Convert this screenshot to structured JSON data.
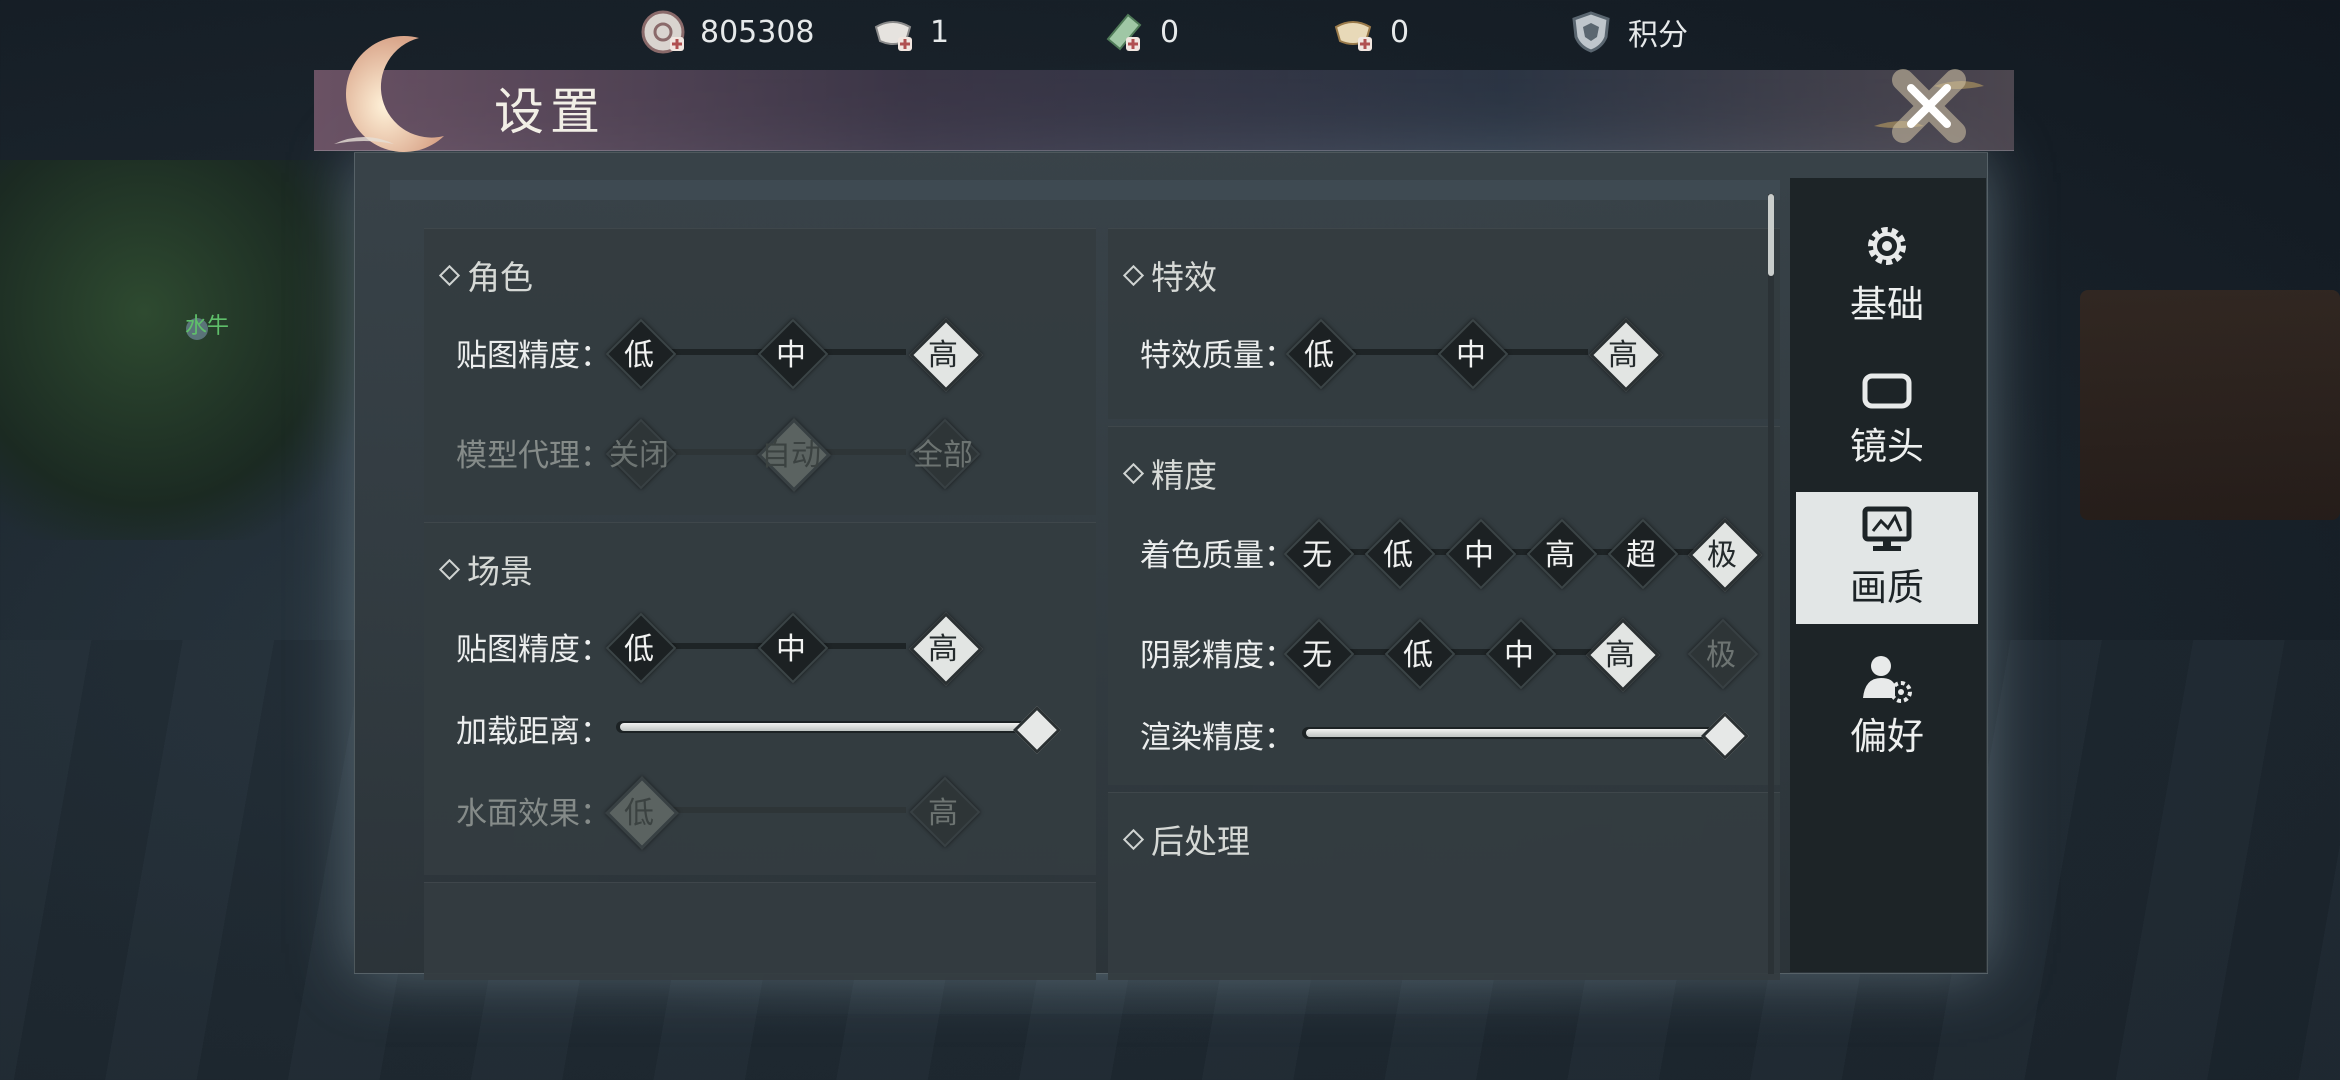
{
  "top_bar": {
    "currencies": [
      {
        "name": "coin-icon",
        "value": "805308"
      },
      {
        "name": "ingot-icon",
        "value": "1"
      },
      {
        "name": "jade-ticket-icon",
        "value": "0"
      },
      {
        "name": "gold-ingot-icon",
        "value": "0"
      }
    ],
    "points_label": "积分"
  },
  "panel": {
    "title": "设置",
    "close_icon": "close-icon"
  },
  "npc_label": "水牛",
  "sections": {
    "character": {
      "title": "角色",
      "texture": {
        "label": "贴图精度：",
        "options": [
          "低",
          "中",
          "高"
        ],
        "selected": "高"
      },
      "model_proxy": {
        "label": "模型代理：",
        "options": [
          "关闭",
          "自动",
          "全部"
        ],
        "selected": "自动",
        "disabled": true
      }
    },
    "scene": {
      "title": "场景",
      "texture": {
        "label": "贴图精度：",
        "options": [
          "低",
          "中",
          "高"
        ],
        "selected": "高"
      },
      "load_distance": {
        "label": "加载距离：",
        "value": 1.0
      },
      "water": {
        "label": "水面效果：",
        "options": [
          "低",
          "高"
        ],
        "selected": "低",
        "disabled": true
      }
    },
    "effects": {
      "title": "特效",
      "quality": {
        "label": "特效质量：",
        "options": [
          "低",
          "中",
          "高"
        ],
        "selected": "高"
      }
    },
    "precision": {
      "title": "精度",
      "shading": {
        "label": "着色质量：",
        "options": [
          "无",
          "低",
          "中",
          "高",
          "超",
          "极"
        ],
        "selected": "极"
      },
      "shadow": {
        "label": "阴影精度：",
        "options": [
          "无",
          "低",
          "中",
          "高",
          "极"
        ],
        "selected": "高",
        "disabled_option": "极"
      },
      "render": {
        "label": "渲染精度：",
        "value": 1.0
      }
    },
    "post": {
      "title": "后处理"
    }
  },
  "tabs": [
    {
      "label": "基础",
      "icon": "gear-icon",
      "active": false
    },
    {
      "label": "镜头",
      "icon": "camera-device-icon",
      "active": false
    },
    {
      "label": "画质",
      "icon": "monitor-icon",
      "active": true
    },
    {
      "label": "偏好",
      "icon": "user-settings-icon",
      "active": false
    }
  ]
}
